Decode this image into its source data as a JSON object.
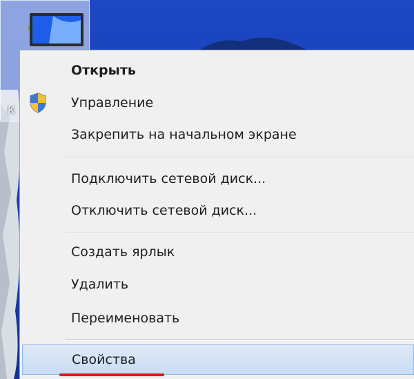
{
  "desktop": {
    "icon_caption": "К"
  },
  "context_menu": {
    "items": [
      {
        "label": "Открыть",
        "bold": true
      },
      {
        "label": "Управление",
        "icon": "uac-shield-icon"
      },
      {
        "label": "Закрепить на начальном экране"
      },
      {
        "label": "Подключить сетевой диск..."
      },
      {
        "label": "Отключить сетевой диск..."
      },
      {
        "label": "Создать ярлык"
      },
      {
        "label": "Удалить"
      },
      {
        "label": "Переименовать"
      },
      {
        "label": "Свойства",
        "highlighted": true
      }
    ]
  },
  "colors": {
    "desktop_blue": "#1b43b9",
    "menu_background": "#f0f0f0",
    "highlight": "#c8dcf4",
    "annotation_underline": "#e01616"
  }
}
